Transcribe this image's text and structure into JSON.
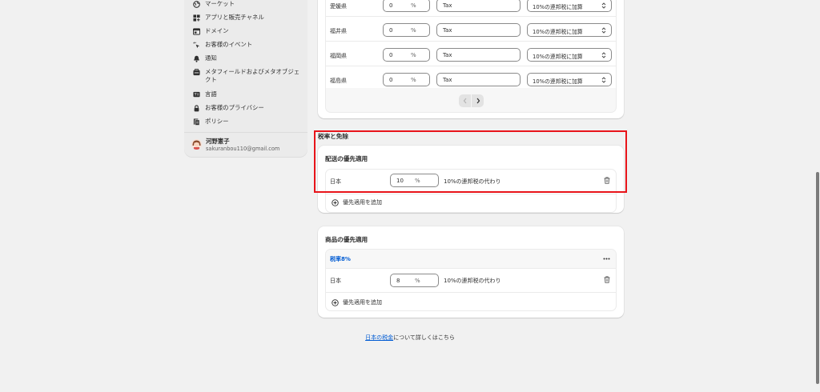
{
  "sidebar": {
    "items": [
      {
        "label": "マーケット",
        "icon": "globe-icon"
      },
      {
        "label": "アプリと販売チャネル",
        "icon": "apps-icon"
      },
      {
        "label": "ドメイン",
        "icon": "domain-icon"
      },
      {
        "label": "お客様のイベント",
        "icon": "cursor-sparkle-icon"
      },
      {
        "label": "通知",
        "icon": "bell-icon"
      },
      {
        "label": "メタフィールドおよびメタオブジェクト",
        "icon": "metafield-icon"
      },
      {
        "label": "言語",
        "icon": "language-icon"
      },
      {
        "label": "お客様のプライバシー",
        "icon": "lock-icon"
      },
      {
        "label": "ポリシー",
        "icon": "policy-icon"
      }
    ],
    "user": {
      "name": "河野憲子",
      "email": "sakuranbou110@gmail.com"
    }
  },
  "regions": {
    "rows": [
      {
        "name": "愛媛県",
        "rate": "0",
        "unit": "%",
        "tax_name": "Tax",
        "method": "10%の連邦税に加算"
      },
      {
        "name": "福井県",
        "rate": "0",
        "unit": "%",
        "tax_name": "Tax",
        "method": "10%の連邦税に加算"
      },
      {
        "name": "福岡県",
        "rate": "0",
        "unit": "%",
        "tax_name": "Tax",
        "method": "10%の連邦税に加算"
      },
      {
        "name": "福島県",
        "rate": "0",
        "unit": "%",
        "tax_name": "Tax",
        "method": "10%の連邦税に加算"
      }
    ]
  },
  "overrides": {
    "section_title": "税率と免除",
    "shipping": {
      "title": "配送の優先適用",
      "row": {
        "region": "日本",
        "rate": "10",
        "unit": "%",
        "description": "10%の連邦税の代わり"
      },
      "add_label": "優先適用を追加"
    },
    "products": {
      "title": "商品の優先適用",
      "collection": "税率8%",
      "row": {
        "region": "日本",
        "rate": "8",
        "unit": "%",
        "description": "10%の連邦税の代わり"
      },
      "add_label": "優先適用を追加"
    }
  },
  "footer": {
    "link": "日本の税金",
    "text": "について詳しくはこちら"
  },
  "colors": {
    "accent": "#005bd3",
    "highlight": "#e8141a"
  }
}
